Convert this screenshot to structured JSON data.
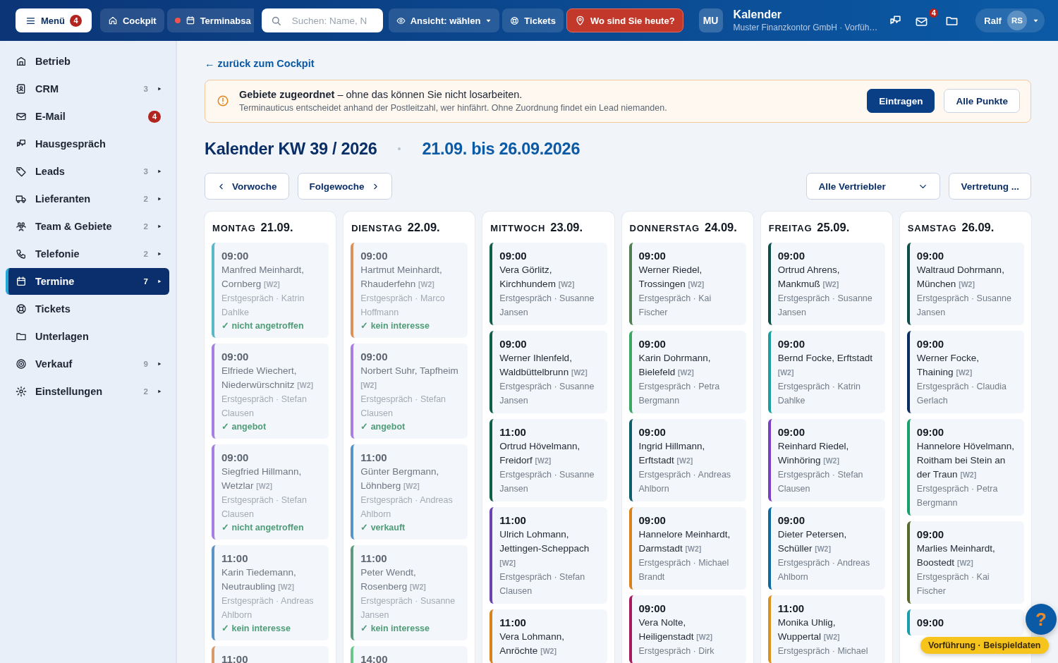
{
  "topbar": {
    "menu_button": {
      "label": "Menü",
      "badge": "4"
    },
    "buttons": [
      {
        "kind": "home",
        "label": "Cockpit",
        "recording": false
      },
      {
        "kind": "calendar",
        "label": "Terminabsa",
        "recording": true
      }
    ],
    "search": {
      "placeholder": "Suchen: Name, N"
    },
    "view_button": {
      "label": "Ansicht: wählen"
    },
    "tickets_button": {
      "label": "Tickets"
    },
    "location_button": {
      "label": "Wo sind Sie heute?"
    },
    "app": {
      "avatar": "MU",
      "title": "Kalender",
      "subtitle": "Muster Finanzkontor GmbH · Vorfüh…"
    },
    "mail_badge": "4",
    "user": {
      "name": "Ralf",
      "initials": "RS"
    }
  },
  "sidebar": {
    "items": [
      {
        "label": "Betrieb",
        "selected": false
      },
      {
        "label": "CRM",
        "count": "3",
        "selected": false
      },
      {
        "label": "E-Mail",
        "badge": "4",
        "selected": false
      },
      {
        "label": "Hausgespräch",
        "selected": false
      },
      {
        "label": "Leads",
        "count": "3",
        "selected": false
      },
      {
        "label": "Lieferanten",
        "count": "2",
        "selected": false
      },
      {
        "label": "Team & Gebiete",
        "count": "2",
        "selected": false
      },
      {
        "label": "Telefonie",
        "count": "2",
        "selected": false
      },
      {
        "label": "Termine",
        "count": "7",
        "selected": true
      },
      {
        "label": "Tickets",
        "selected": false
      },
      {
        "label": "Unterlagen",
        "selected": false
      },
      {
        "label": "Verkauf",
        "count": "9",
        "selected": false
      },
      {
        "label": "Einstellungen",
        "count": "2",
        "selected": false
      }
    ]
  },
  "back_link": "← zurück zum Cockpit",
  "notice": {
    "text": "**Gebiete zugeordnet** – ohne das können Sie nicht losarbeiten.",
    "detail": "Terminauticus entscheidet anhand der Postleitzahl, wer hinfährt. Ohne Zuordnung findet ein Lead niemanden.",
    "buttons": [
      {
        "kind": "primary",
        "label": "Eintragen"
      },
      {
        "kind": "secondary",
        "label": "Alle Punkte"
      }
    ]
  },
  "heading": {
    "title": "Kalender KW 39 / 2026",
    "range": "21.09. bis 26.09.2026"
  },
  "week_nav": {
    "prev": "Vorwoche",
    "next": "Folgewoche",
    "filter": "Alle Vertriebler",
    "deputy": "Vertretung ..."
  },
  "days": [
    {
      "name": "MONTAG",
      "date": "21.09.",
      "appointments": [
        {
          "time": "09:00",
          "name": "Manfred Meinhardt, Cornberg",
          "tag": "[W2]",
          "meta": "Erstgespräch · Katrin Dahlke",
          "result": "✓ nicht angetroffen",
          "past": true,
          "color": "#5bb8c8"
        },
        {
          "time": "09:00",
          "name": "Elfriede Wiechert, Niederwürschnitz",
          "tag": "[W2]",
          "meta": "Erstgespräch · Stefan Clausen",
          "result": "✓ angebot",
          "past": true,
          "color": "#a67fe2"
        },
        {
          "time": "09:00",
          "name": "Siegfried Hillmann, Wetzlar",
          "tag": "[W2]",
          "meta": "Erstgespräch · Stefan Clausen",
          "result": "✓ nicht angetroffen",
          "past": true,
          "color": "#a67fe2"
        },
        {
          "time": "11:00",
          "name": "Karin Tiedemann, Neutraubling",
          "tag": "[W2]",
          "meta": "Erstgespräch · Andreas Ahlborn",
          "result": "✓ kein interesse",
          "past": true,
          "color": "#5a93c6"
        },
        {
          "time": "11:00",
          "past": true,
          "color": "#d99a6a"
        }
      ]
    },
    {
      "name": "DIENSTAG",
      "date": "22.09.",
      "appointments": [
        {
          "time": "09:00",
          "name": "Hartmut Meinhardt, Rhauderfehn",
          "tag": "[W2]",
          "meta": "Erstgespräch · Marco Hoffmann",
          "result": "✓ kein interesse",
          "past": true,
          "color": "#d9925c"
        },
        {
          "time": "09:00",
          "name": "Norbert Suhr, Tapfheim",
          "tag": "[W2]",
          "meta": "Erstgespräch · Stefan Clausen",
          "result": "✓ angebot",
          "past": true,
          "color": "#a67fe2"
        },
        {
          "time": "11:00",
          "name": "Günter Bergmann, Löhnberg",
          "tag": "[W2]",
          "meta": "Erstgespräch · Andreas Ahlborn",
          "result": "✓ verkauft",
          "past": true,
          "color": "#5a93c6"
        },
        {
          "time": "11:00",
          "name": "Peter Wendt, Rosenberg",
          "tag": "[W2]",
          "meta": "Erstgespräch · Susanne Jansen",
          "result": "✓ kein interesse",
          "past": true,
          "color": "#5e9a7c"
        },
        {
          "time": "14:00",
          "past": true,
          "color": "#6cc68c"
        }
      ]
    },
    {
      "name": "MITTWOCH",
      "date": "23.09.",
      "appointments": [
        {
          "time": "09:00",
          "name": "Vera Görlitz, Kirchhundem",
          "tag": "[W2]",
          "meta": "Erstgespräch · Susanne Jansen",
          "past": false,
          "color": "#0f5e48"
        },
        {
          "time": "09:00",
          "name": "Werner Ihlenfeld, Waldbüttelbrunn",
          "tag": "[W2]",
          "meta": "Erstgespräch · Susanne Jansen",
          "past": false,
          "color": "#0f5e48"
        },
        {
          "time": "11:00",
          "name": "Ortrud Hövelmann, Freidorf",
          "tag": "[W2]",
          "meta": "Erstgespräch · Susanne Jansen",
          "past": false,
          "color": "#0f5e48"
        },
        {
          "time": "11:00",
          "name": "Ulrich Lohmann, Jettingen-Scheppach",
          "tag": "[W2]",
          "meta": "Erstgespräch · Stefan Clausen",
          "past": false,
          "color": "#6a42b2"
        },
        {
          "time": "11:00",
          "name": "Vera Lohmann, Anröchte",
          "tag": "[W2]",
          "past": false,
          "color": "#d9821c"
        }
      ]
    },
    {
      "name": "DONNERSTAG",
      "date": "24.09.",
      "appointments": [
        {
          "time": "09:00",
          "name": "Werner Riedel, Trossingen",
          "tag": "[W2]",
          "meta": "Erstgespräch · Kai Fischer",
          "past": false,
          "color": "#4f7e50"
        },
        {
          "time": "09:00",
          "name": "Karin Dohrmann, Bielefeld",
          "tag": "[W2]",
          "meta": "Erstgespräch · Petra Bergmann",
          "past": false,
          "color": "#3aa862"
        },
        {
          "time": "09:00",
          "name": "Ingrid Hillmann, Erftstadt",
          "tag": "[W2]",
          "meta": "Erstgespräch · Andreas Ahlborn",
          "past": false,
          "color": "#0d5e6c"
        },
        {
          "time": "09:00",
          "name": "Hannelore Meinhardt, Darmstadt",
          "tag": "[W2]",
          "meta": "Erstgespräch · Michael Brandt",
          "past": false,
          "color": "#d9821c"
        },
        {
          "time": "09:00",
          "name": "Vera Nolte, Heiligenstadt",
          "tag": "[W2]",
          "meta": "Erstgespräch · Dirk",
          "past": false,
          "color": "#a81a60"
        }
      ]
    },
    {
      "name": "FREITAG",
      "date": "25.09.",
      "appointments": [
        {
          "time": "09:00",
          "name": "Ortrud Ahrens, Mankmuß",
          "tag": "[W2]",
          "meta": "Erstgespräch · Susanne Jansen",
          "past": false,
          "color": "#0d4e4a"
        },
        {
          "time": "09:00",
          "name": "Bernd Focke, Erftstadt",
          "tag": "[W2]",
          "meta": "Erstgespräch · Katrin Dahlke",
          "past": false,
          "color": "#1a9e9e"
        },
        {
          "time": "09:00",
          "name": "Reinhard Riedel, Winhöring",
          "tag": "[W2]",
          "meta": "Erstgespräch · Stefan Clausen",
          "past": false,
          "color": "#7a40c2"
        },
        {
          "time": "09:00",
          "name": "Dieter Petersen, Schüller",
          "tag": "[W2]",
          "meta": "Erstgespräch · Andreas Ahlborn",
          "past": false,
          "color": "#0d6aa0"
        },
        {
          "time": "11:00",
          "name": "Monika Uhlig, Wuppertal",
          "tag": "[W2]",
          "meta": "Erstgespräch · Michael",
          "past": false,
          "color": "#d9921c"
        }
      ]
    },
    {
      "name": "SAMSTAG",
      "date": "26.09.",
      "appointments": [
        {
          "time": "09:00",
          "name": "Waltraud Dohrmann, München",
          "tag": "[W2]",
          "meta": "Erstgespräch · Susanne Jansen",
          "past": false,
          "color": "#0d4e4a"
        },
        {
          "time": "09:00",
          "name": "Werner Focke, Thaining",
          "tag": "[W2]",
          "meta": "Erstgespräch · Claudia Gerlach",
          "past": false,
          "color": "#0d2e62"
        },
        {
          "time": "09:00",
          "name": "Hannelore Hövelmann, Roitham bei Stein an der Traun",
          "tag": "[W2]",
          "meta": "Erstgespräch · Petra Bergmann",
          "past": false,
          "color": "#1aa06c"
        },
        {
          "time": "09:00",
          "name": "Marlies Meinhardt, Boostedt",
          "tag": "[W2]",
          "meta": "Erstgespräch · Kai Fischer",
          "past": false,
          "color": "#5a6a2c"
        },
        {
          "time": "09:00",
          "past": false,
          "color": "#1a9eac"
        }
      ]
    }
  ],
  "help_button": {
    "label": "?"
  },
  "demo_badge": "Vorführung · Beispieldaten"
}
